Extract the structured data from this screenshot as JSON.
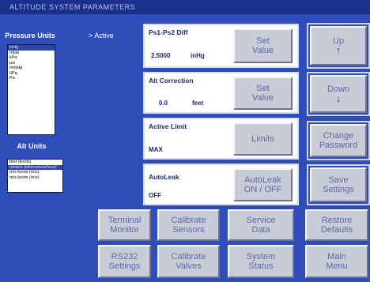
{
  "window": {
    "title": "ALTITUDE SYSTEM PARAMETERS"
  },
  "left": {
    "pressure_units_label": "Pressure Units",
    "active_label": "> Active",
    "pressure_units": [
      "inHg",
      "mbar",
      "kPa",
      "psi",
      "mmHg",
      "hPa",
      "Pa"
    ],
    "pressure_selected_index": 0,
    "alt_units_label": "Alt Units",
    "alt_units": [
      "feet (knots)",
      "meters (kilometers/hour)",
      "m/s knots (m/s)",
      "m/s knots (m/s)"
    ],
    "alt_selected_index": 1
  },
  "panels": {
    "ps_diff": {
      "title": "Ps1-Ps2 Diff",
      "value": "2.5000",
      "unit": "inHg",
      "button": [
        "Set",
        "Value"
      ]
    },
    "alt_correction": {
      "title": "Alt Correction",
      "value": "0.0",
      "unit": "feet",
      "button": [
        "Set",
        "Value"
      ]
    },
    "active_limit": {
      "title": "Active Limit",
      "value": "MAX",
      "button": [
        "Limits"
      ]
    },
    "autoleak": {
      "title": "AutoLeak",
      "value": "OFF",
      "button": [
        "AutoLeak",
        "ON / OFF"
      ]
    }
  },
  "right_buttons": {
    "up": {
      "label": "Up",
      "icon": "arrow-up-icon"
    },
    "down": {
      "label": "Down",
      "icon": "arrow-down-icon"
    },
    "change_password": [
      "Change",
      "Password"
    ],
    "save_settings": [
      "Save",
      "Settings"
    ]
  },
  "bottom_buttons": {
    "terminal_monitor": [
      "Terminal",
      "Monitor"
    ],
    "calibrate_sensors": [
      "Calibrate",
      "Sensors"
    ],
    "service_data": [
      "Service",
      "Data"
    ],
    "restore_defaults": [
      "Restore",
      "Defaults"
    ],
    "rs232_settings": [
      "RS232",
      "Settings"
    ],
    "calibrate_valves": [
      "Calibrate",
      "Valves"
    ],
    "system_status": [
      "System",
      "Status"
    ],
    "main_menu": [
      "Main",
      "Menu"
    ]
  },
  "colors": {
    "background": "#2f4db8",
    "title_bar": "#1b2f8c",
    "button_face": "#c9ccd6",
    "button_text": "#5a6aa8",
    "panel_text": "#1d2a6a",
    "selection": "#2b44b0"
  }
}
